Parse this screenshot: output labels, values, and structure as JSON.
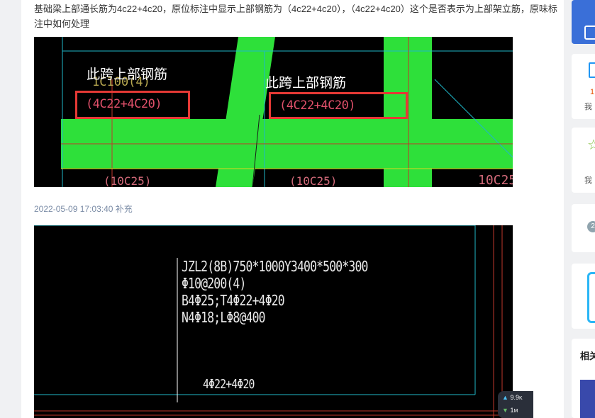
{
  "question": {
    "text": "基础梁上部通长筋为4c22+4c20，原位标注中显示上部钢筋为（4c22+4c20），（4c22+4c20）这个是否表示为上部架立筋，原味标注中如何处理"
  },
  "image1": {
    "overlay_labels": [
      "此跨上部钢筋",
      "此跨上部钢筋"
    ],
    "boxed_text": [
      "(4C22+4C20)",
      "(4C22+4C20)"
    ],
    "background_texts": [
      "1C100(4)",
      "(10C25)",
      "(10C25)",
      "10C25"
    ]
  },
  "supplement": {
    "timestamp": "2022-05-09 17:03:40 补充"
  },
  "image2": {
    "lines": [
      "JZL2(8B)750*1000Y3400*500*300",
      "Φ10@200(4)",
      "B4Φ25;T4Φ22+4Φ20",
      "N4Φ18;LΦ8@400"
    ],
    "bottom_text": "4Φ22+4Φ20"
  },
  "speed_widget": {
    "upload": "9.9",
    "upload_unit": "K",
    "download": "1",
    "download_unit": "M"
  },
  "right_rail": {
    "card2_value": "1",
    "card2_label": "我",
    "card3_label": "我",
    "card6_label": "相关"
  },
  "colors": {
    "beam_green": "#2ee03a",
    "cad_background": "#000000",
    "highlight_red": "#e53935",
    "timestamp_blue": "#7b8ca6"
  }
}
